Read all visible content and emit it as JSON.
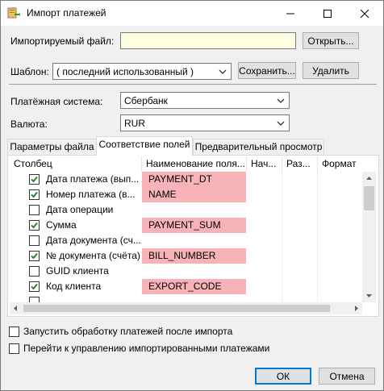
{
  "window": {
    "title": "Импорт платежей",
    "minimize_glyph": "—",
    "maximize_glyph": "☐",
    "close_glyph": "✕"
  },
  "file": {
    "label": "Импортируемый файл:",
    "value": "",
    "open_button": "Открыть..."
  },
  "template": {
    "label": "Шаблон:",
    "value": "( последний использованный )",
    "save_button": "Сохранить...",
    "delete_button": "Удалить"
  },
  "payment_system": {
    "label": "Платёжная система:",
    "value": "Сбербанк"
  },
  "currency": {
    "label": "Валюта:",
    "value": "RUR"
  },
  "tabs": [
    {
      "label": "Параметры файла",
      "active": false
    },
    {
      "label": "Соответствие полей",
      "active": true
    },
    {
      "label": "Предварительный просмотр",
      "active": false
    }
  ],
  "grid": {
    "columns": [
      "Столбец",
      "Наименование поля...",
      "Нач...",
      "Раз...",
      "Формат"
    ],
    "rows": [
      {
        "checked": true,
        "name": "Дата платежа (вып...",
        "mapping": "PAYMENT_DT"
      },
      {
        "checked": true,
        "name": "Номер платежа (в...",
        "mapping": "NAME"
      },
      {
        "checked": false,
        "name": "Дата операции",
        "mapping": ""
      },
      {
        "checked": true,
        "name": "Сумма",
        "mapping": "PAYMENT_SUM"
      },
      {
        "checked": false,
        "name": "Дата документа (сч...",
        "mapping": ""
      },
      {
        "checked": true,
        "name": "№ документа (счёта)",
        "mapping": "BILL_NUMBER"
      },
      {
        "checked": false,
        "name": "GUID клиента",
        "mapping": ""
      },
      {
        "checked": true,
        "name": "Код клиента",
        "mapping": "EXPORT_CODE"
      },
      {
        "checked": false,
        "name": "",
        "mapping": ""
      }
    ],
    "mapping_fill_color": "#f7b3b8"
  },
  "options": [
    {
      "checked": false,
      "label": "Запустить обработку платежей после импорта"
    },
    {
      "checked": false,
      "label": "Перейти к управлению импортированными платежами"
    }
  ],
  "footer": {
    "ok_button": "ОК",
    "cancel_button": "Отмена"
  }
}
